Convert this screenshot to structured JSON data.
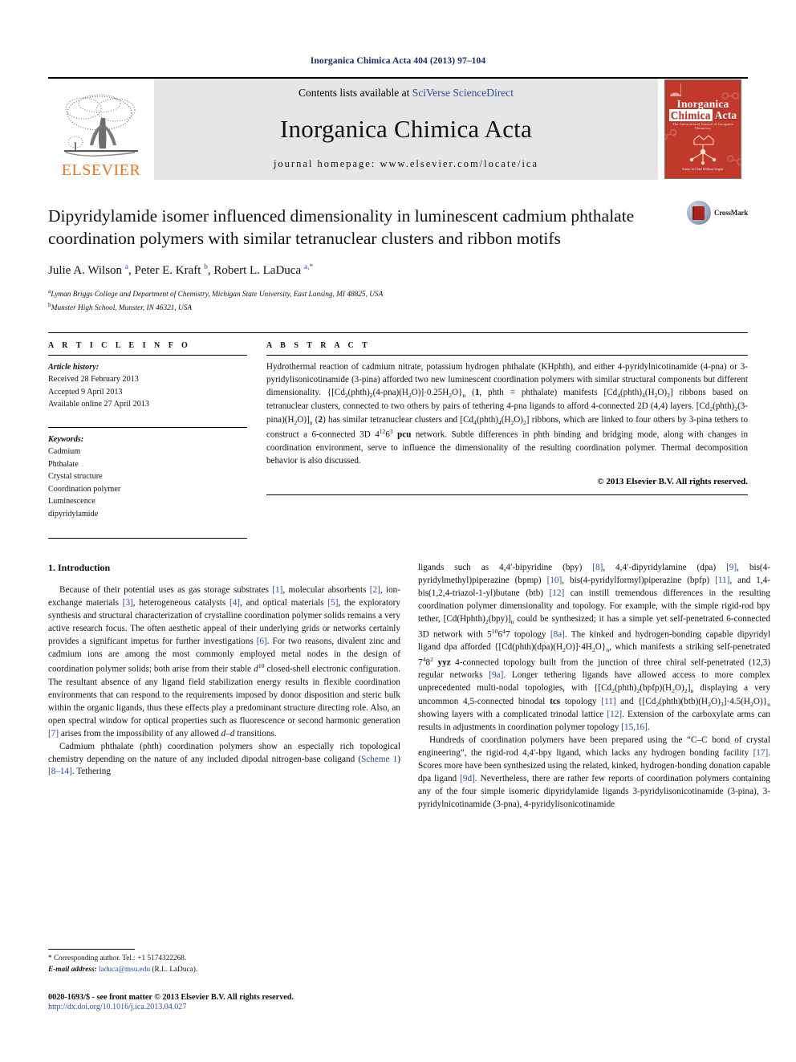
{
  "running_head": "Inorganica Chimica Acta 404 (2013) 97–104",
  "masthead": {
    "publisher_logo_text": "ELSEVIER",
    "contents_prefix": "Contents lists available at ",
    "contents_link": "SciVerse ScienceDirect",
    "journal_title": "Inorganica Chimica Acta",
    "homepage_label": "journal homepage: www.elsevier.com/locate/ica",
    "cover": {
      "line1": "Inorganica",
      "line2_a": "Chimica",
      "line2_b": "Acta",
      "subtitle": "The International Journal of Inorganic Chemistry",
      "footer": "Editor-in-Chief\nWilliam Trogler"
    }
  },
  "article": {
    "title": "Dipyridylamide isomer influenced dimensionality in luminescent cadmium phthalate coordination polymers with similar tetranuclear clusters and ribbon motifs",
    "crossmark_label": "CrossMark",
    "authors_html": "Julie A. Wilson <sup>a</sup>, Peter E. Kraft <sup>b</sup>, Robert L. LaDuca <sup>a,*</sup>",
    "affiliations": [
      {
        "marker": "a",
        "text": "Lyman Briggs College and Department of Chemistry, Michigan State University, East Lansing, MI 48825, USA"
      },
      {
        "marker": "b",
        "text": "Munster High School, Munster, IN 46321, USA"
      }
    ]
  },
  "article_info": {
    "heading": "A R T I C L E    I N F O",
    "history_label": "Article history:",
    "history": [
      "Received 28 February 2013",
      "Accepted 9 April 2013",
      "Available online 27 April 2013"
    ],
    "keywords_label": "Keywords:",
    "keywords": [
      "Cadmium",
      "Phthalate",
      "Crystal structure",
      "Coordination polymer",
      "Luminescence",
      "dipyridylamide"
    ]
  },
  "abstract": {
    "heading": "A B S T R A C T",
    "body_html": "Hydrothermal reaction of cadmium nitrate, potassium hydrogen phthalate (KHphth), and either 4-pyridylnicotinamide (4-pna) or 3-pyridylisonicotinamide (3-pina) afforded two new luminescent coordination polymers with similar structural components but different dimensionality. {[Cd<sub>2</sub>(phth)<sub>2</sub>(4-pna)(H<sub>2</sub>O)]·0.25H<sub>2</sub>O}<sub>n</sub> (<b>1</b>, phth = phthalate) manifests [Cd<sub>4</sub>(phth)<sub>4</sub>(H<sub>2</sub>O)<sub>2</sub>] ribbons based on tetranuclear clusters, connected to two others by pairs of tethering 4-pna ligands to afford 4-connected 2D (4,4) layers. [Cd<sub>2</sub>(phth)<sub>2</sub>(3-pina)(H<sub>2</sub>O)]<sub>n</sub> (<b>2</b>) has similar tetranuclear clusters and [Cd<sub>4</sub>(phth)<sub>4</sub>(H<sub>2</sub>O)<sub>2</sub>] ribbons, which are linked to four others by 3-pina tethers to construct a 6-connected 3D 4<sup>12</sup>6<sup>3</sup> <b>pcu</b> network. Subtle differences in phth binding and bridging mode, along with changes in coordination environment, serve to influence the dimensionality of the resulting coordination polymer. Thermal decomposition behavior is also discussed.",
    "copyright": "© 2013 Elsevier B.V. All rights reserved."
  },
  "body": {
    "section_title": "1. Introduction",
    "left_paragraphs_html": [
      "Because of their potential uses as gas storage substrates <span class=\"ref\">[1]</span>, molecular absorbents <span class=\"ref\">[2]</span>, ion-exchange materials <span class=\"ref\">[3]</span>, heterogeneous catalysts <span class=\"ref\">[4]</span>, and optical materials <span class=\"ref\">[5]</span>, the exploratory synthesis and structural characterization of crystalline coordination polymer solids remains a very active research focus. The often aesthetic appeal of their underlying grids or networks certainly provides a significant impetus for further investigations <span class=\"ref\">[6]</span>. For two reasons, divalent zinc and cadmium ions are among the most commonly employed metal nodes in the design of coordination polymer solids; both arise from their stable <i>d</i><sup>10</sup> closed-shell electronic configuration. The resultant absence of any ligand field stabilization energy results in flexible coordination environments that can respond to the requirements imposed by donor disposition and steric bulk within the organic ligands, thus these effects play a predominant structure directing role. Also, an open spectral window for optical properties such as fluorescence or second harmonic generation <span class=\"ref\">[7]</span> arises from the impossibility of any allowed <i>d</i>–<i>d</i> transitions.",
      "Cadmium phthalate (phth) coordination polymers show an especially rich topological chemistry depending on the nature of any included dipodal nitrogen-base coligand (<span class=\"ref\">Scheme 1</span>) <span class=\"ref\">[8–14]</span>. Tethering"
    ],
    "right_paragraphs_html": [
      "ligands such as 4,4′-bipyridine (bpy) <span class=\"ref\">[8]</span>, 4,4′-dipyridylamine (dpa) <span class=\"ref\">[9]</span>, bis(4-pyridylmethyl)piperazine (bpmp) <span class=\"ref\">[10]</span>, bis(4-pyridylformyl)piperazine (bpfp) <span class=\"ref\">[11]</span>, and 1,4-bis(1,2,4-triazol-1-yl)butane (btb) <span class=\"ref\">[12]</span> can instill tremendous differences in the resulting coordination polymer dimensionality and topology. For example, with the simple rigid-rod bpy tether, [Cd(Hphth)<sub>2</sub>(bpy)]<sub>n</sub> could be synthesized; it has a simple yet self-penetrated 6-connected 3D network with 5<sup>10</sup>6<sup>4</sup>7 topology <span class=\"ref\">[8a]</span>. The kinked and hydrogen-bonding capable dipyridyl ligand dpa afforded {[Cd(phth)(dpa)(H<sub>2</sub>O)]·4H<sub>2</sub>O}<sub>n</sub>, which manifests a striking self-penetrated 7<sup>4</sup>8<sup>2</sup> <b>yyz</b> 4-connected topology built from the junction of three chiral self-penetrated (12,3) regular networks <span class=\"ref\">[9a]</span>. Longer tethering ligands have allowed access to more complex unprecedented multi-nodal topologies, with {[Cd<sub>2</sub>(phth)<sub>2</sub>(bpfp)(H<sub>2</sub>O)<sub>2</sub>]<sub>n</sub> displaying a very uncommon 4,5-connected binodal <b>tcs</b> topology <span class=\"ref\">[11]</span> and {[Cd<sub>2</sub>(phth)(btb)(H<sub>2</sub>O)<sub>3</sub>]·4.5(H<sub>2</sub>O)}<sub>n</sub> showing layers with a complicated trinodal lattice <span class=\"ref\">[12]</span>. Extension of the carboxylate arms can results in adjustments in coordination polymer topology <span class=\"ref\">[15,16]</span>.",
      "Hundreds of coordination polymers have been prepared using the “C–C bond of crystal engineering”, the rigid-rod 4,4′-bpy ligand, which lacks any hydrogen bonding facility <span class=\"ref\">[17]</span>. Scores more have been synthesized using the related, kinked, hydrogen-bonding donation capable dpa ligand <span class=\"ref\">[9d]</span>. Nevertheless, there are rather few reports of coordination polymers containing any of the four simple isomeric dipyridylamide ligands 3-pyridylisonicotinamide (3-pina), 3-pyridylnicotinamide (3-pna), 4-pyridylisonicotinamide"
    ]
  },
  "footnote": {
    "corresponding_html": "* Corresponding author. Tel.: +1 5174322268.",
    "email_label": "E-mail address:",
    "email": "laduca@msu.edu",
    "email_suffix": " (R.L. LaDuca)."
  },
  "footer": {
    "line1": "0020-1693/$ - see front matter © 2013 Elsevier B.V. All rights reserved.",
    "line2": "http://dx.doi.org/10.1016/j.ica.2013.04.027"
  }
}
